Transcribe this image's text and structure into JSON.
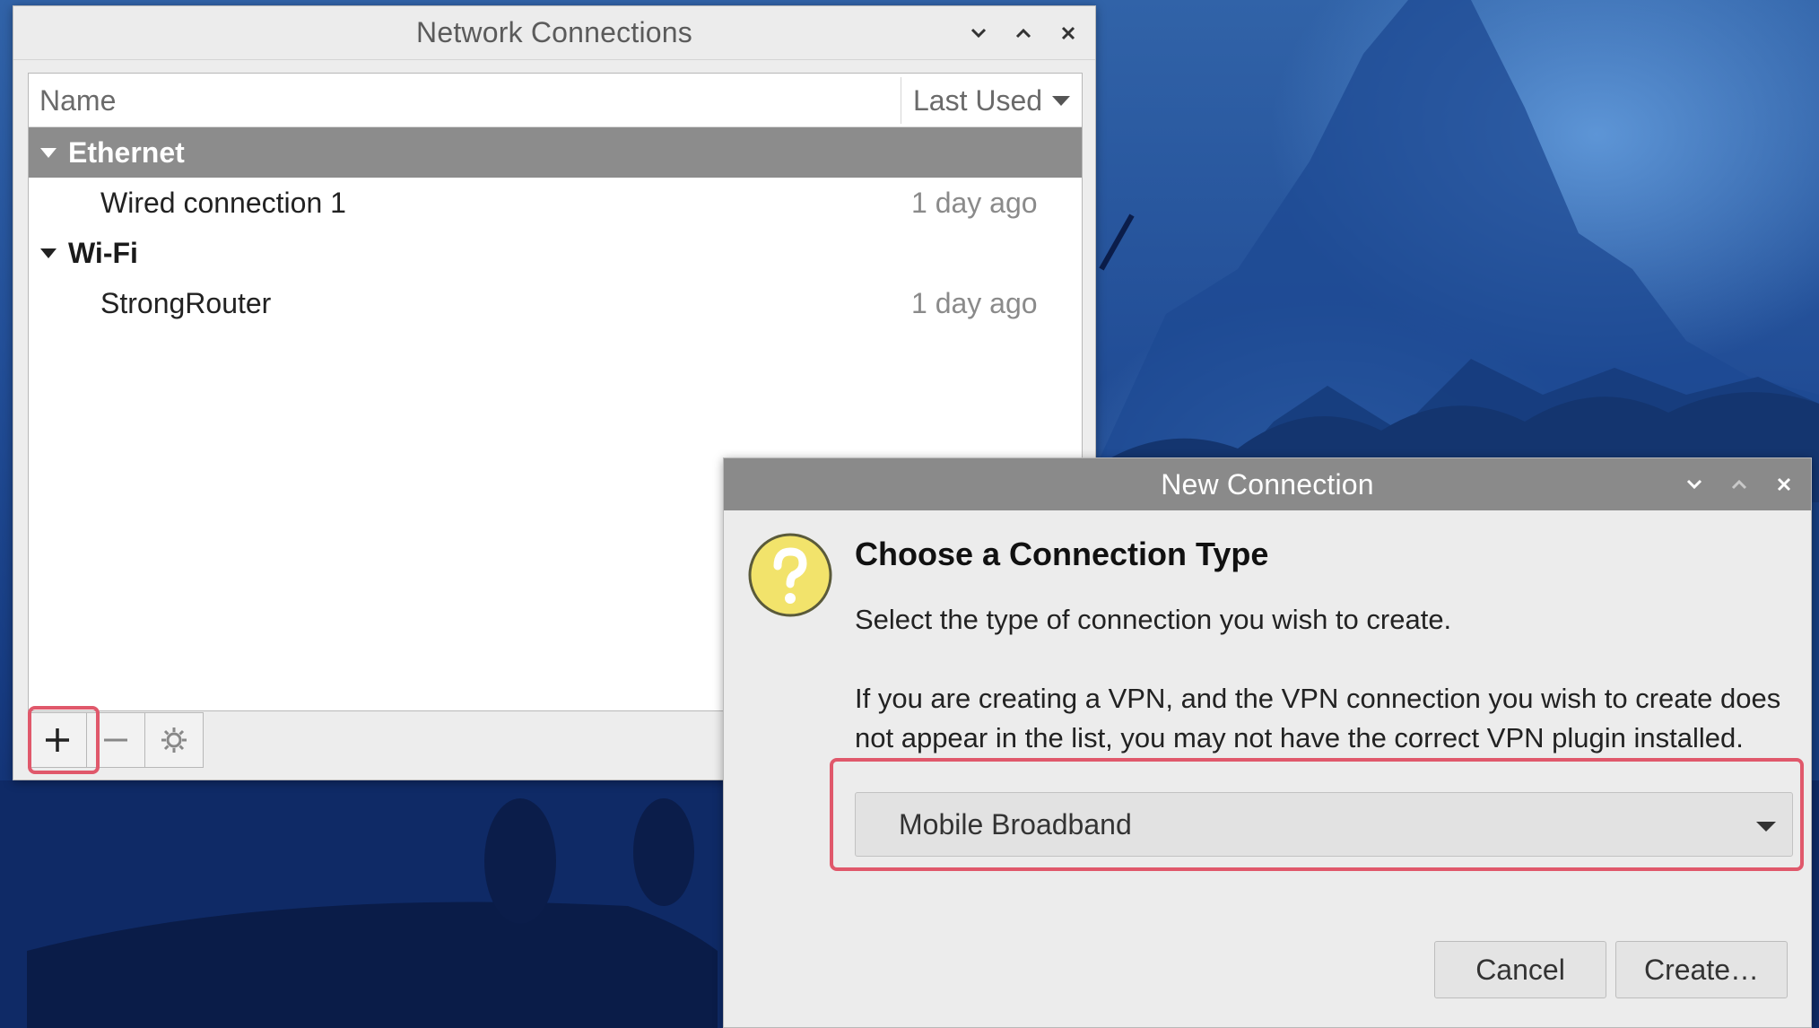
{
  "network_window": {
    "title": "Network Connections",
    "columns": {
      "name": "Name",
      "last_used": "Last Used"
    },
    "groups": [
      {
        "label": "Ethernet",
        "connections": [
          {
            "name": "Wired connection 1",
            "last_used": "1 day ago"
          }
        ]
      },
      {
        "label": "Wi-Fi",
        "connections": [
          {
            "name": "StrongRouter",
            "last_used": "1 day ago"
          }
        ]
      }
    ],
    "toolbar": {
      "add": "+",
      "remove": "–"
    }
  },
  "dialog": {
    "title": "New Connection",
    "heading": "Choose a Connection Type",
    "text1": "Select the type of connection you wish to create.",
    "text2": "If you are creating a VPN, and the VPN connection you wish to create does not appear in the list, you may not have the correct VPN plugin installed.",
    "connection_type": "Mobile Broadband",
    "cancel": "Cancel",
    "create": "Create…"
  },
  "colors": {
    "selected_row": "#8c8c8c",
    "highlight": "#e0586b",
    "question_icon": "#f2e36b"
  }
}
